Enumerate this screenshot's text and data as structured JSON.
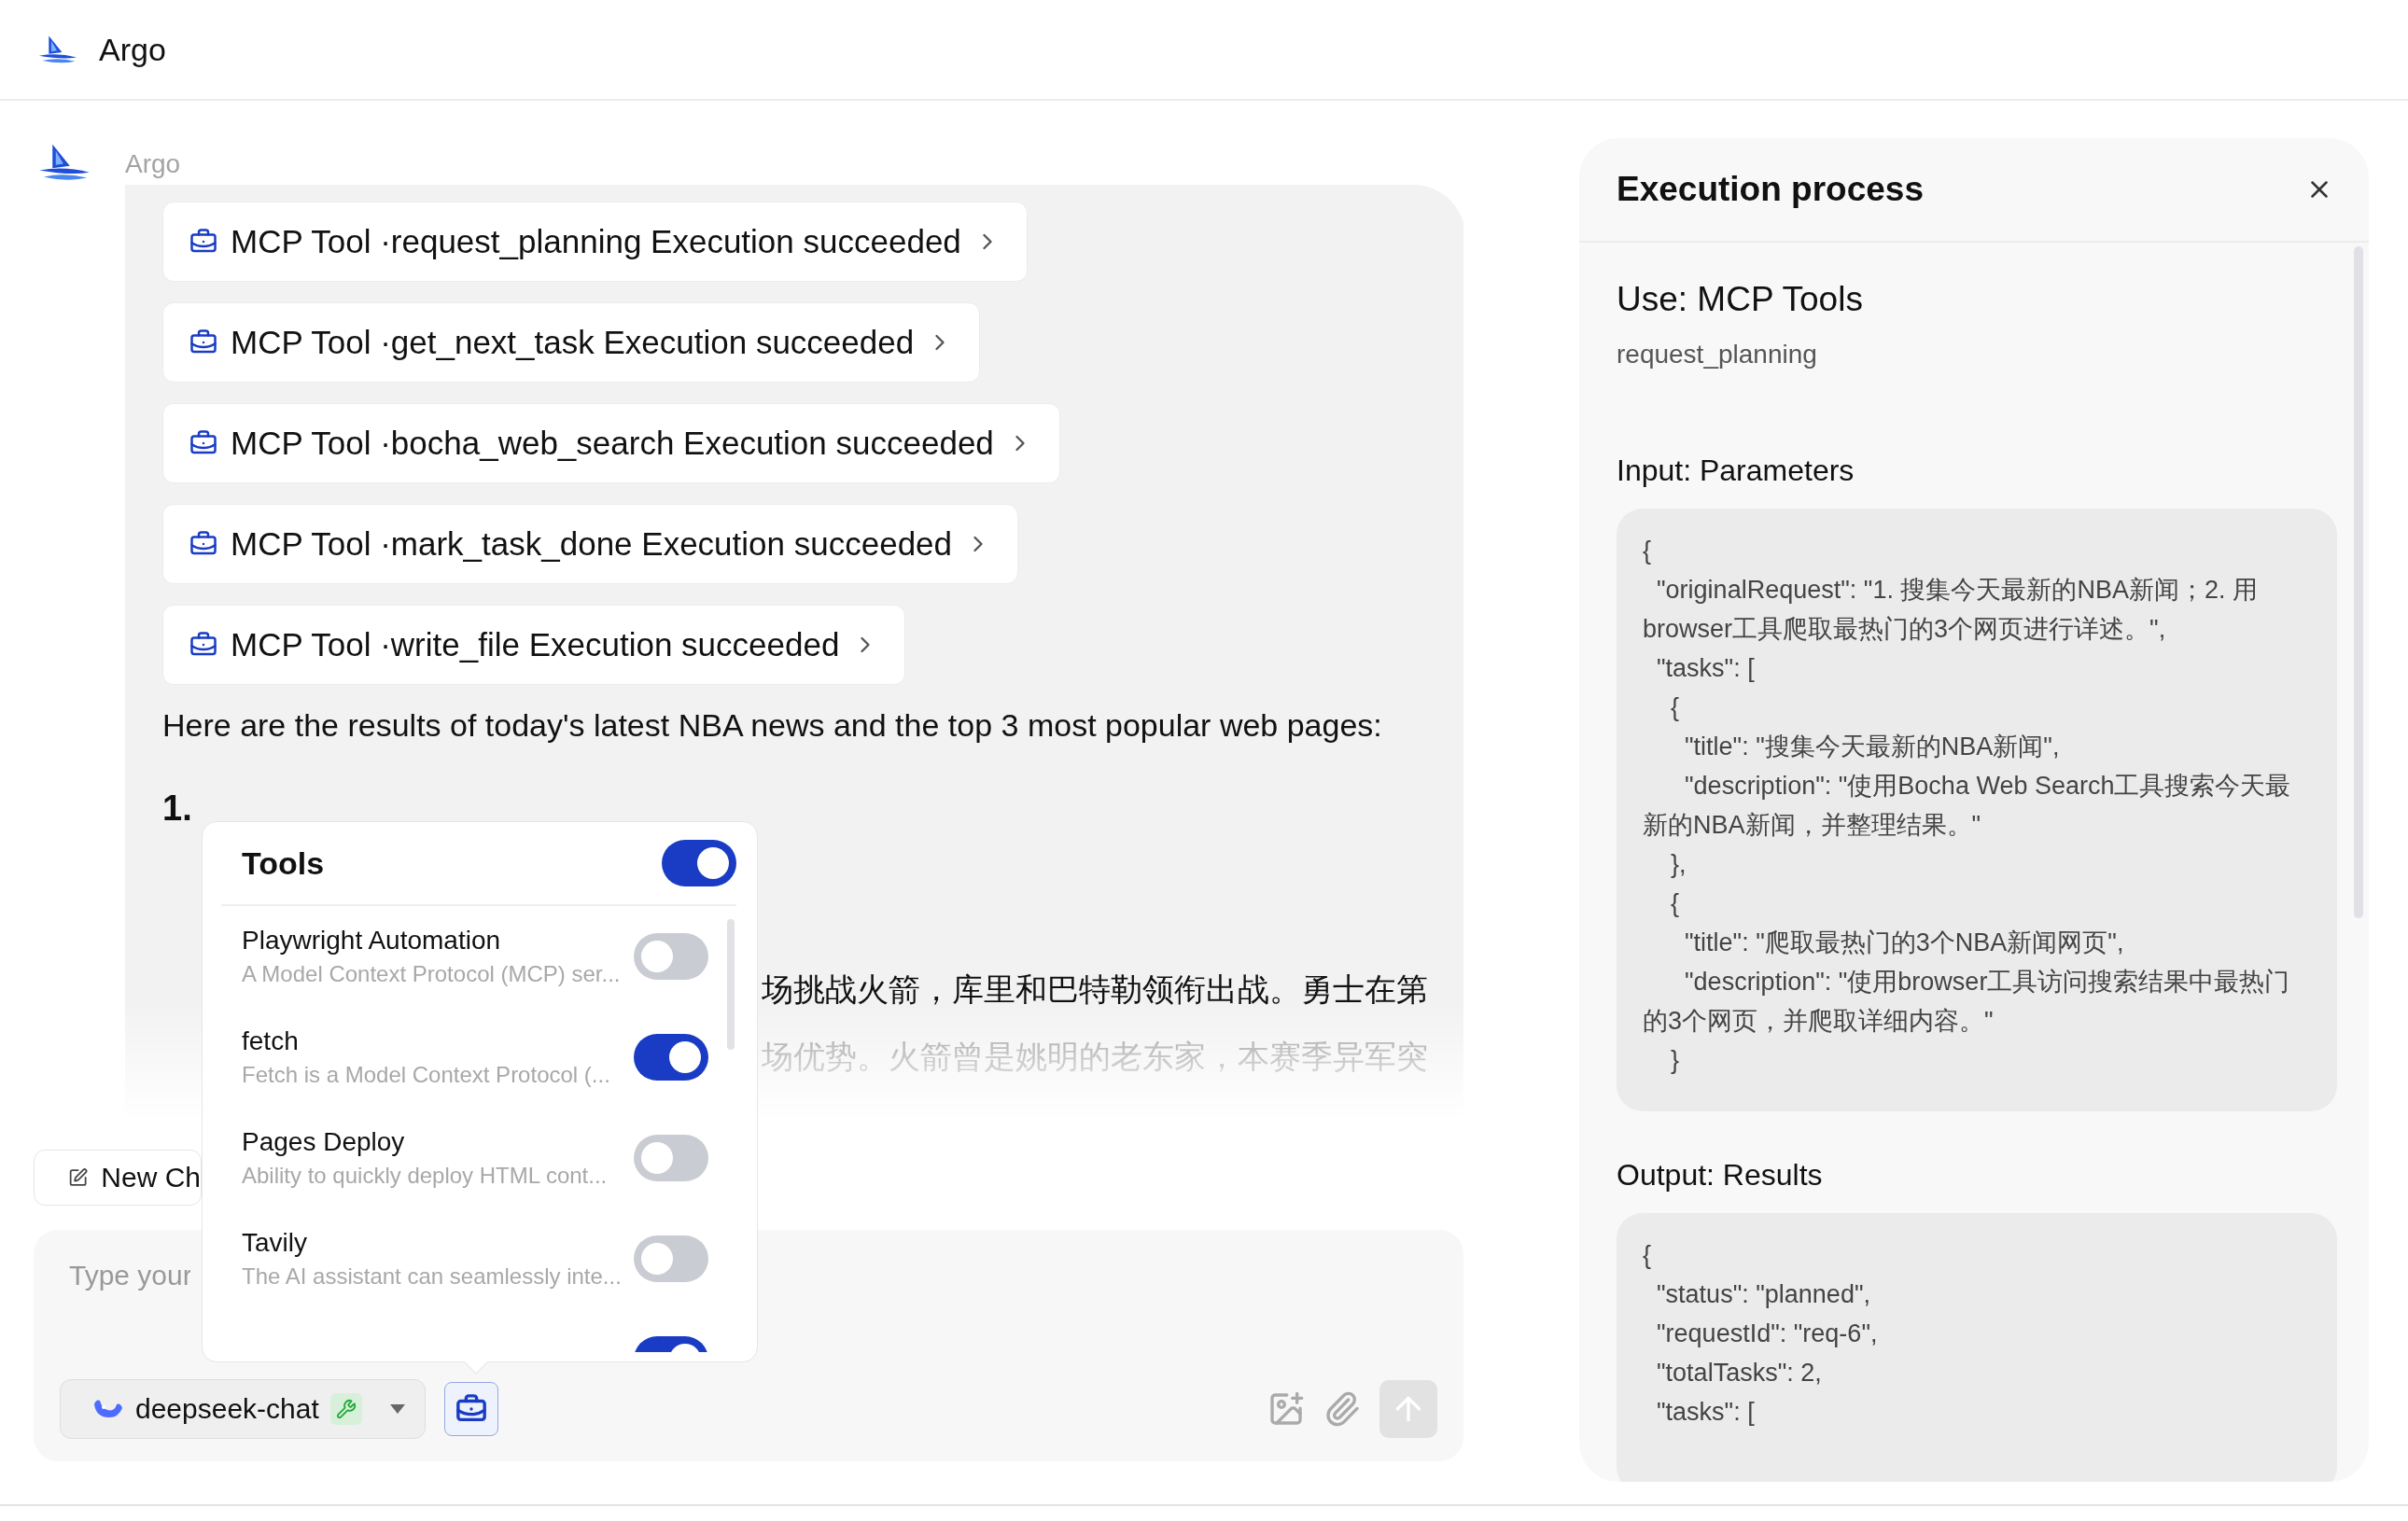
{
  "app": {
    "title": "Argo"
  },
  "message": {
    "sender": "Argo",
    "tool_calls": [
      "MCP Tool ·request_planning Execution succeeded",
      "MCP Tool ·get_next_task Execution succeeded",
      "MCP Tool ·bocha_web_search Execution succeeded",
      "MCP Tool ·mark_task_done Execution succeeded",
      "MCP Tool ·write_file Execution succeeded"
    ],
    "intro": "Here are the results of today's latest NBA news and the top 3 most popular web pages:",
    "list_number": "1.",
    "excerpt_lines": [
      "场挑战火箭，库里和巴特勒领衔出战。勇士在第",
      "场优势。火箭曾是姚明的老东家，本赛季异军突"
    ]
  },
  "new_chat": {
    "label": "New Ch"
  },
  "composer": {
    "placeholder": "Type your",
    "model": "deepseek-chat",
    "tools_selected": true
  },
  "tools_popup": {
    "title": "Tools",
    "on": true,
    "items": [
      {
        "name": "Playwright Automation",
        "description": "A Model Context Protocol (MCP) ser...",
        "on": false
      },
      {
        "name": "fetch",
        "description": "Fetch is a Model Context Protocol (...",
        "on": true
      },
      {
        "name": "Pages Deploy",
        "description": "Ability to quickly deploy HTML cont...",
        "on": false
      },
      {
        "name": "Tavily",
        "description": "The AI assistant can seamlessly inte...",
        "on": false
      },
      {
        "on": true
      }
    ]
  },
  "panel": {
    "title": "Execution process",
    "section_title": "Use: MCP Tools",
    "tool_name": "request_planning",
    "input_title": "Input: Parameters",
    "input_code": "{\n  \"originalRequest\": \"1. 搜集今天最新的NBA新闻；2. 用browser工具爬取最热门的3个网页进行详述。\",\n  \"tasks\": [\n    {\n      \"title\": \"搜集今天最新的NBA新闻\",\n      \"description\": \"使用Bocha Web Search工具搜索今天最新的NBA新闻，并整理结果。\"\n    },\n    {\n      \"title\": \"爬取最热门的3个NBA新闻网页\",\n      \"description\": \"使用browser工具访问搜索结果中最热门的3个网页，并爬取详细内容。\"\n    }",
    "output_title": "Output: Results",
    "output_code": "{\n  \"status\": \"planned\",\n  \"requestId\": \"req-6\",\n  \"totalTasks\": 2,\n  \"tasks\": ["
  }
}
